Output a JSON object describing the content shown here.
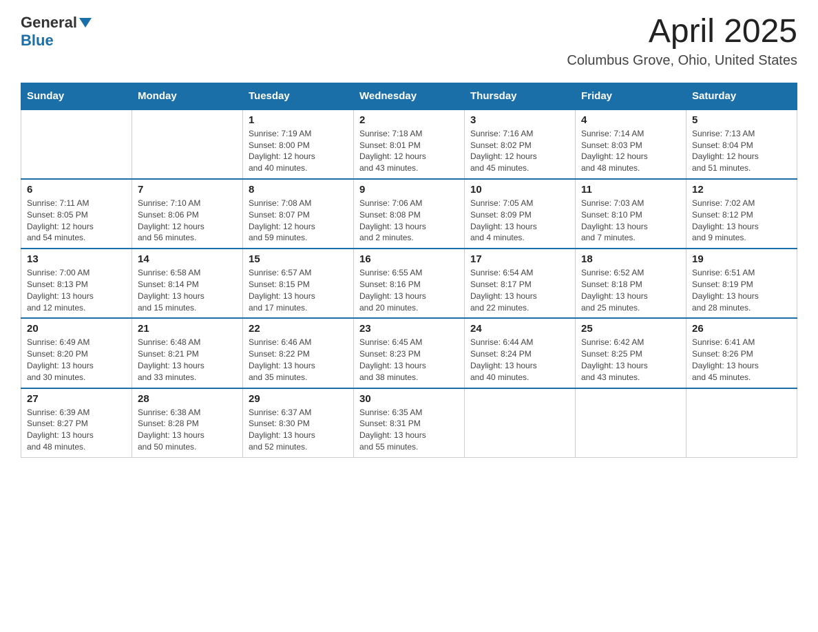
{
  "logo": {
    "text_general": "General",
    "text_blue": "Blue"
  },
  "header": {
    "month_year": "April 2025",
    "location": "Columbus Grove, Ohio, United States"
  },
  "days_of_week": [
    "Sunday",
    "Monday",
    "Tuesday",
    "Wednesday",
    "Thursday",
    "Friday",
    "Saturday"
  ],
  "weeks": [
    [
      {
        "day": "",
        "info": ""
      },
      {
        "day": "",
        "info": ""
      },
      {
        "day": "1",
        "info": "Sunrise: 7:19 AM\nSunset: 8:00 PM\nDaylight: 12 hours\nand 40 minutes."
      },
      {
        "day": "2",
        "info": "Sunrise: 7:18 AM\nSunset: 8:01 PM\nDaylight: 12 hours\nand 43 minutes."
      },
      {
        "day": "3",
        "info": "Sunrise: 7:16 AM\nSunset: 8:02 PM\nDaylight: 12 hours\nand 45 minutes."
      },
      {
        "day": "4",
        "info": "Sunrise: 7:14 AM\nSunset: 8:03 PM\nDaylight: 12 hours\nand 48 minutes."
      },
      {
        "day": "5",
        "info": "Sunrise: 7:13 AM\nSunset: 8:04 PM\nDaylight: 12 hours\nand 51 minutes."
      }
    ],
    [
      {
        "day": "6",
        "info": "Sunrise: 7:11 AM\nSunset: 8:05 PM\nDaylight: 12 hours\nand 54 minutes."
      },
      {
        "day": "7",
        "info": "Sunrise: 7:10 AM\nSunset: 8:06 PM\nDaylight: 12 hours\nand 56 minutes."
      },
      {
        "day": "8",
        "info": "Sunrise: 7:08 AM\nSunset: 8:07 PM\nDaylight: 12 hours\nand 59 minutes."
      },
      {
        "day": "9",
        "info": "Sunrise: 7:06 AM\nSunset: 8:08 PM\nDaylight: 13 hours\nand 2 minutes."
      },
      {
        "day": "10",
        "info": "Sunrise: 7:05 AM\nSunset: 8:09 PM\nDaylight: 13 hours\nand 4 minutes."
      },
      {
        "day": "11",
        "info": "Sunrise: 7:03 AM\nSunset: 8:10 PM\nDaylight: 13 hours\nand 7 minutes."
      },
      {
        "day": "12",
        "info": "Sunrise: 7:02 AM\nSunset: 8:12 PM\nDaylight: 13 hours\nand 9 minutes."
      }
    ],
    [
      {
        "day": "13",
        "info": "Sunrise: 7:00 AM\nSunset: 8:13 PM\nDaylight: 13 hours\nand 12 minutes."
      },
      {
        "day": "14",
        "info": "Sunrise: 6:58 AM\nSunset: 8:14 PM\nDaylight: 13 hours\nand 15 minutes."
      },
      {
        "day": "15",
        "info": "Sunrise: 6:57 AM\nSunset: 8:15 PM\nDaylight: 13 hours\nand 17 minutes."
      },
      {
        "day": "16",
        "info": "Sunrise: 6:55 AM\nSunset: 8:16 PM\nDaylight: 13 hours\nand 20 minutes."
      },
      {
        "day": "17",
        "info": "Sunrise: 6:54 AM\nSunset: 8:17 PM\nDaylight: 13 hours\nand 22 minutes."
      },
      {
        "day": "18",
        "info": "Sunrise: 6:52 AM\nSunset: 8:18 PM\nDaylight: 13 hours\nand 25 minutes."
      },
      {
        "day": "19",
        "info": "Sunrise: 6:51 AM\nSunset: 8:19 PM\nDaylight: 13 hours\nand 28 minutes."
      }
    ],
    [
      {
        "day": "20",
        "info": "Sunrise: 6:49 AM\nSunset: 8:20 PM\nDaylight: 13 hours\nand 30 minutes."
      },
      {
        "day": "21",
        "info": "Sunrise: 6:48 AM\nSunset: 8:21 PM\nDaylight: 13 hours\nand 33 minutes."
      },
      {
        "day": "22",
        "info": "Sunrise: 6:46 AM\nSunset: 8:22 PM\nDaylight: 13 hours\nand 35 minutes."
      },
      {
        "day": "23",
        "info": "Sunrise: 6:45 AM\nSunset: 8:23 PM\nDaylight: 13 hours\nand 38 minutes."
      },
      {
        "day": "24",
        "info": "Sunrise: 6:44 AM\nSunset: 8:24 PM\nDaylight: 13 hours\nand 40 minutes."
      },
      {
        "day": "25",
        "info": "Sunrise: 6:42 AM\nSunset: 8:25 PM\nDaylight: 13 hours\nand 43 minutes."
      },
      {
        "day": "26",
        "info": "Sunrise: 6:41 AM\nSunset: 8:26 PM\nDaylight: 13 hours\nand 45 minutes."
      }
    ],
    [
      {
        "day": "27",
        "info": "Sunrise: 6:39 AM\nSunset: 8:27 PM\nDaylight: 13 hours\nand 48 minutes."
      },
      {
        "day": "28",
        "info": "Sunrise: 6:38 AM\nSunset: 8:28 PM\nDaylight: 13 hours\nand 50 minutes."
      },
      {
        "day": "29",
        "info": "Sunrise: 6:37 AM\nSunset: 8:30 PM\nDaylight: 13 hours\nand 52 minutes."
      },
      {
        "day": "30",
        "info": "Sunrise: 6:35 AM\nSunset: 8:31 PM\nDaylight: 13 hours\nand 55 minutes."
      },
      {
        "day": "",
        "info": ""
      },
      {
        "day": "",
        "info": ""
      },
      {
        "day": "",
        "info": ""
      }
    ]
  ]
}
